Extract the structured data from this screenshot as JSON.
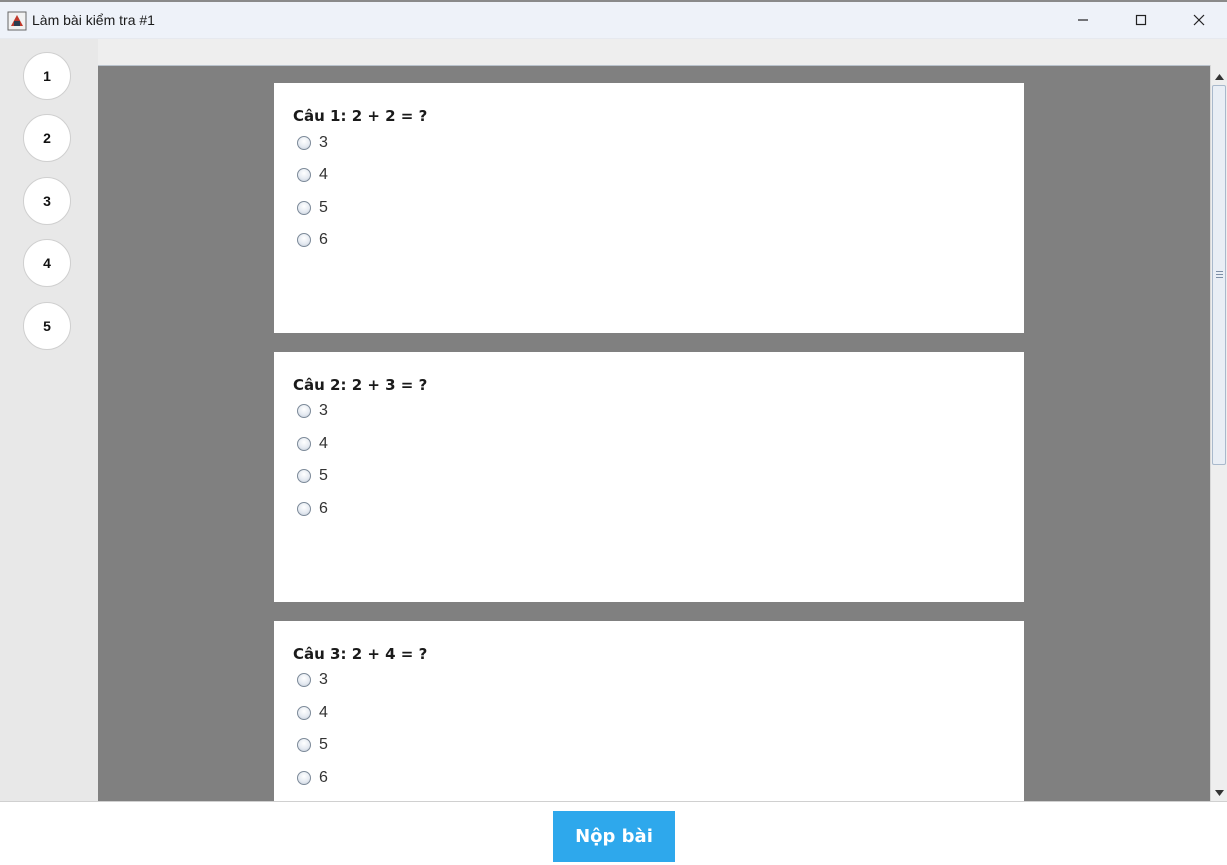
{
  "window": {
    "title": "Làm bài kiểm tra #1",
    "icons": {
      "app": "java-app-icon",
      "minimize": "minimize-icon",
      "maximize": "maximize-icon",
      "close": "close-icon"
    }
  },
  "navigator": {
    "items": [
      "1",
      "2",
      "3",
      "4",
      "5"
    ]
  },
  "questions": [
    {
      "title": "Câu 1: 2 + 2 = ?",
      "options": [
        "3",
        "4",
        "5",
        "6"
      ]
    },
    {
      "title": "Câu 2: 2 + 3 = ?",
      "options": [
        "3",
        "4",
        "5",
        "6"
      ]
    },
    {
      "title": "Câu 3: 2 + 4 = ?",
      "options": [
        "3",
        "4",
        "5",
        "6"
      ]
    }
  ],
  "footer": {
    "submit_label": "Nộp bài"
  },
  "colors": {
    "accent": "#2ea8ec",
    "content_background": "#808080",
    "navigator_background": "#e8e8e8"
  }
}
